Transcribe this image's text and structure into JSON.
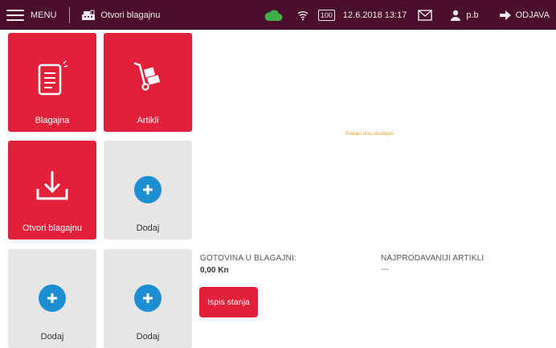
{
  "topbar": {
    "menu_label": "MENU",
    "current_page": "Otvori blagajnu",
    "battery": "100",
    "datetime": "12.6.2018 13:17",
    "user": "p.b",
    "logout_label": "ODJAVA"
  },
  "tiles": [
    {
      "label": "Blagajna",
      "icon": "receipt-icon"
    },
    {
      "label": "Artikli",
      "icon": "hand-truck-icon"
    },
    {
      "label": "Otvori blagajnu",
      "icon": "download-tray-icon"
    },
    {
      "label": "Dodaj",
      "icon": "plus-icon"
    },
    {
      "label": "Dodaj",
      "icon": "plus-icon"
    },
    {
      "label": "Dodaj",
      "icon": "plus-icon"
    }
  ],
  "main": {
    "empty_message": "Podaci nisu dostupni",
    "cash_label": "GOTOVINA U BLAGAJNI:",
    "cash_value": "0,00 Kn",
    "top_items_label": "NAJPRODAVANIJI ARTIKLI",
    "top_items_value": "---",
    "print_button": "Ispis stanja"
  },
  "colors": {
    "topbar": "#4a0f2a",
    "accent_red": "#e3203a",
    "tile_gray": "#e8e6e4",
    "plus_blue": "#1c8fd3",
    "cloud_green": "#3fae49"
  }
}
